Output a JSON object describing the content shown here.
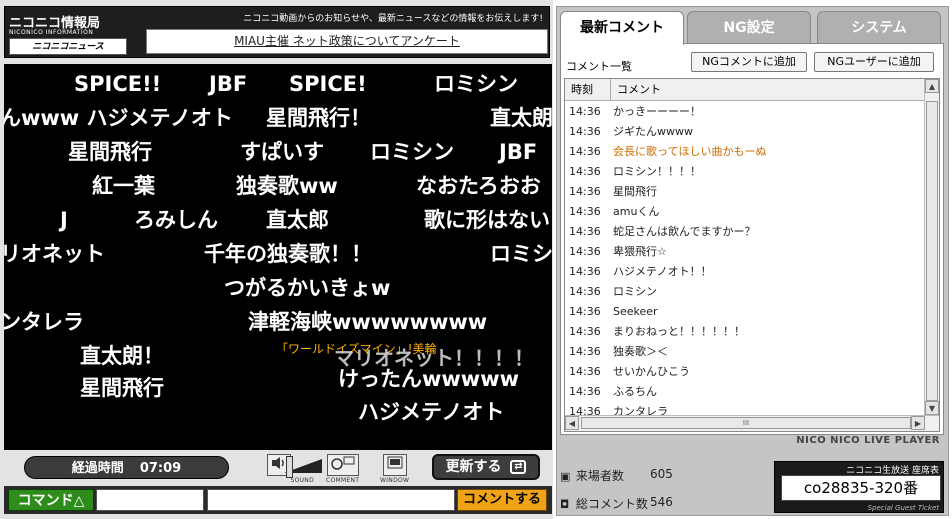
{
  "info_bar": {
    "logo_title": "ニコニコ情報局",
    "logo_sub": "NICONICO INFORMATION",
    "logo_news": "ニコニコニュース",
    "notice": "ニコニコ動画からのお知らせや、最新ニュースなどの情報をお伝えします!",
    "news_link": "MIAU主催 ネット政策についてアンケート"
  },
  "overlay_comments": [
    "SPICE!!",
    "JBF",
    "SPICE!",
    "ロミシン",
    "んwww ハジメテノオト",
    "星間飛行！",
    "直太朗",
    "星間飛行",
    "すぱいす",
    "ロミシン",
    "JBF",
    "紅一葉",
    "独奏歌ww",
    "なおたろおお",
    "J",
    "ろみしん",
    "直太郎",
    "歌に形はない",
    "リオネット",
    "千年の独奏歌！！",
    "ロミシ",
    "つがるかいきょw",
    "ンタレラ",
    "津軽海峡wwwwwwww",
    "「ワールドイズマイン」!美輪",
    "マリオネット！！！！",
    "直太朗！",
    "けったんwwwww",
    "星間飛行",
    "ハジメテノオト"
  ],
  "controls": {
    "elapsed_label": "経過時間",
    "elapsed_time": "07:09",
    "sound_label": "SOUND",
    "comment_label": "COMMENT",
    "window_label": "WINDOW",
    "refresh_label": "更新する"
  },
  "comment_row": {
    "command_label": "コマンド△",
    "command_value": "",
    "message_value": "",
    "submit_label": "コメントする"
  },
  "tabs": {
    "comments": "最新コメント",
    "ng": "NG設定",
    "system": "システム"
  },
  "list": {
    "title": "コメント一覧",
    "btn_ng_comment": "NGコメントに追加",
    "btn_ng_user": "NGユーザーに追加",
    "col_time": "時刻",
    "col_comment": "コメント",
    "rows": [
      {
        "time": "14:36",
        "text": "かっきーーーー！",
        "highlight": false
      },
      {
        "time": "14:36",
        "text": "ジギたんwwww",
        "highlight": false
      },
      {
        "time": "14:36",
        "text": "会長に歌ってほしい曲かもーぬ",
        "highlight": true
      },
      {
        "time": "14:36",
        "text": "ロミシン！！！！",
        "highlight": false
      },
      {
        "time": "14:36",
        "text": "星間飛行",
        "highlight": false
      },
      {
        "time": "14:36",
        "text": "amuくん",
        "highlight": false
      },
      {
        "time": "14:36",
        "text": "蛇足さんは飲んでますかー？",
        "highlight": false
      },
      {
        "time": "14:36",
        "text": "卑猥飛行☆",
        "highlight": false
      },
      {
        "time": "14:36",
        "text": "ハジメテノオト！！",
        "highlight": false
      },
      {
        "time": "14:36",
        "text": "ロミシン",
        "highlight": false
      },
      {
        "time": "14:36",
        "text": "Seekeer",
        "highlight": false
      },
      {
        "time": "14:36",
        "text": "まりおねっと！！！！！！",
        "highlight": false
      },
      {
        "time": "14:36",
        "text": "独奏歌＞＜",
        "highlight": false
      },
      {
        "time": "14:36",
        "text": "せいかんひこう",
        "highlight": false
      },
      {
        "time": "14:36",
        "text": "ふるちん",
        "highlight": false
      },
      {
        "time": "14:36",
        "text": "カンタレラ",
        "highlight": false
      }
    ],
    "scroll_thumb_label": "III"
  },
  "brand": "NICO NICO LIVE PLAYER",
  "stats": {
    "visitors_label": "来場者数",
    "visitors": "605",
    "comments_label": "総コメント数",
    "comments": "546"
  },
  "ticket": {
    "title": "ニコニコ生放送 座席表",
    "seat": "co28835-320番",
    "footer": "Special Guest Ticket"
  },
  "colors": {
    "video_bg": "#000000",
    "command_green": "#2e8c1b",
    "submit_orange": "#f0a317",
    "highlight_comment": "#d06a00"
  },
  "icons": [
    "sound-icon",
    "comment-icon",
    "window-icon",
    "refresh-icon",
    "visitors-icon",
    "comments-count-icon"
  ]
}
